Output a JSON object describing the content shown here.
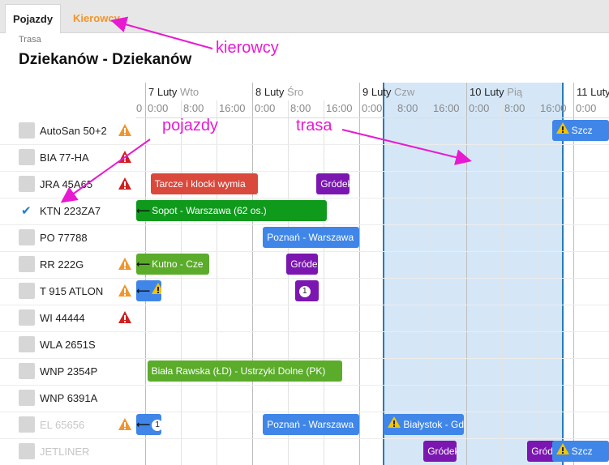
{
  "tabs": [
    {
      "label": "Pojazdy",
      "active": true
    },
    {
      "label": "Kierowcy",
      "active": false
    }
  ],
  "route": {
    "caption": "Trasa",
    "title": "Dziekanów - Dziekanów"
  },
  "timeline": {
    "days": [
      {
        "num": "",
        "weekday": ""
      },
      {
        "num": "7 Luty",
        "weekday": "Wto"
      },
      {
        "num": "8 Luty",
        "weekday": "Śro"
      },
      {
        "num": "9 Luty",
        "weekday": "Czw"
      },
      {
        "num": "10 Luty",
        "weekday": "Pią"
      },
      {
        "num": "11 Luty",
        "weekday": ""
      }
    ],
    "hour_labels": [
      "0",
      "0:00",
      "8:00",
      "16:00",
      "0:00",
      "8:00",
      "16:00",
      "0:00",
      "8:00",
      "16:00",
      "0:00",
      "8:00",
      "16:00",
      "0:00"
    ]
  },
  "vehicles": [
    {
      "name": "AutoSan 50+2",
      "checked": false,
      "warning": "orange",
      "dim": false
    },
    {
      "name": "BIA 77-HA",
      "checked": false,
      "warning": "red",
      "dim": false
    },
    {
      "name": "JRA 45A65",
      "checked": false,
      "warning": "red",
      "dim": false
    },
    {
      "name": "KTN 223ZA7",
      "checked": true,
      "warning": "",
      "dim": false
    },
    {
      "name": "PO 77788",
      "checked": false,
      "warning": "",
      "dim": false
    },
    {
      "name": "RR 222G",
      "checked": false,
      "warning": "orange",
      "dim": false
    },
    {
      "name": "T 915 ATLON",
      "checked": false,
      "warning": "orange",
      "dim": false
    },
    {
      "name": "WI 44444",
      "checked": false,
      "warning": "red",
      "dim": false
    },
    {
      "name": "WLA 2651S",
      "checked": false,
      "warning": "",
      "dim": false
    },
    {
      "name": "WNP 2354P",
      "checked": false,
      "warning": "",
      "dim": false
    },
    {
      "name": "WNP 6391A",
      "checked": false,
      "warning": "",
      "dim": false
    },
    {
      "name": "EL 65656",
      "checked": false,
      "warning": "orange",
      "dim": true
    },
    {
      "name": "JETLINER",
      "checked": false,
      "warning": "",
      "dim": true
    }
  ],
  "bars": [
    {
      "row": 0,
      "start": 4.8,
      "end": 5.4,
      "label": "Szcz",
      "color": "#3f86e8",
      "warn": true,
      "badge": "",
      "arrow": false
    },
    {
      "row": 2,
      "start": 1.05,
      "end": 2.05,
      "label": "Tarcze i klocki wymia",
      "color": "#d9493c",
      "warn": false,
      "badge": "",
      "arrow": false
    },
    {
      "row": 2,
      "start": 2.6,
      "end": 2.91,
      "label": "Gródek",
      "color": "#7b17b0",
      "warn": false,
      "badge": "",
      "arrow": false
    },
    {
      "row": 3,
      "start": 0.9,
      "end": 2.7,
      "label": "Sopot - Warszawa (62 os.)",
      "color": "#0f9a1c",
      "warn": false,
      "badge": "",
      "arrow": true
    },
    {
      "row": 4,
      "start": 2.1,
      "end": 3.0,
      "label": "Poznań - Warszawa",
      "color": "#3f86e8",
      "warn": false,
      "badge": "",
      "arrow": false
    },
    {
      "row": 5,
      "start": 0.9,
      "end": 1.6,
      "label": "Kutno - Cze",
      "color": "#5aac2a",
      "warn": false,
      "badge": "",
      "arrow": true
    },
    {
      "row": 5,
      "start": 2.32,
      "end": 2.61,
      "label": "Gródek",
      "color": "#7b17b0",
      "warn": false,
      "badge": "",
      "arrow": false
    },
    {
      "row": 6,
      "start": 0.9,
      "end": 1.15,
      "label": "",
      "color": "#3f86e8",
      "warn": true,
      "badge": "",
      "arrow": true
    },
    {
      "row": 6,
      "start": 2.4,
      "end": 2.62,
      "label": "",
      "color": "#7b17b0",
      "warn": false,
      "badge": "1",
      "arrow": false
    },
    {
      "row": 9,
      "start": 1.02,
      "end": 2.84,
      "label": "Biała Rawska (ŁD) - Ustrzyki Dolne (PK)",
      "color": "#5aac2a",
      "warn": false,
      "badge": "",
      "arrow": false
    },
    {
      "row": 11,
      "start": 0.9,
      "end": 1.15,
      "label": "",
      "color": "#3f86e8",
      "warn": false,
      "badge": "1",
      "arrow": true
    },
    {
      "row": 11,
      "start": 2.1,
      "end": 3.0,
      "label": "Poznań - Warszawa",
      "color": "#3f86e8",
      "warn": false,
      "badge": "",
      "arrow": false
    },
    {
      "row": 11,
      "start": 3.23,
      "end": 3.98,
      "label": "Białystok - Gd",
      "color": "#3f86e8",
      "warn": true,
      "badge": "",
      "arrow": false
    },
    {
      "row": 12,
      "start": 3.6,
      "end": 3.91,
      "label": "Gródek",
      "color": "#7b17b0",
      "warn": false,
      "badge": "",
      "arrow": false
    },
    {
      "row": 12,
      "start": 4.57,
      "end": 4.88,
      "label": "Gródek",
      "color": "#7b17b0",
      "warn": false,
      "badge": "",
      "arrow": false
    },
    {
      "row": 12,
      "start": 4.8,
      "end": 5.4,
      "label": "Szcz",
      "color": "#3f86e8",
      "warn": true,
      "badge": "",
      "arrow": false
    }
  ],
  "annotations": {
    "kierowcy": "kierowcy",
    "pojazdy": "pojazdy",
    "trasa": "trasa"
  },
  "colors": {
    "accent": "#f0962b",
    "annotation": "#e81ad1",
    "highlight": "#d5e7f7",
    "highlight_edge": "#2a7ab8"
  }
}
